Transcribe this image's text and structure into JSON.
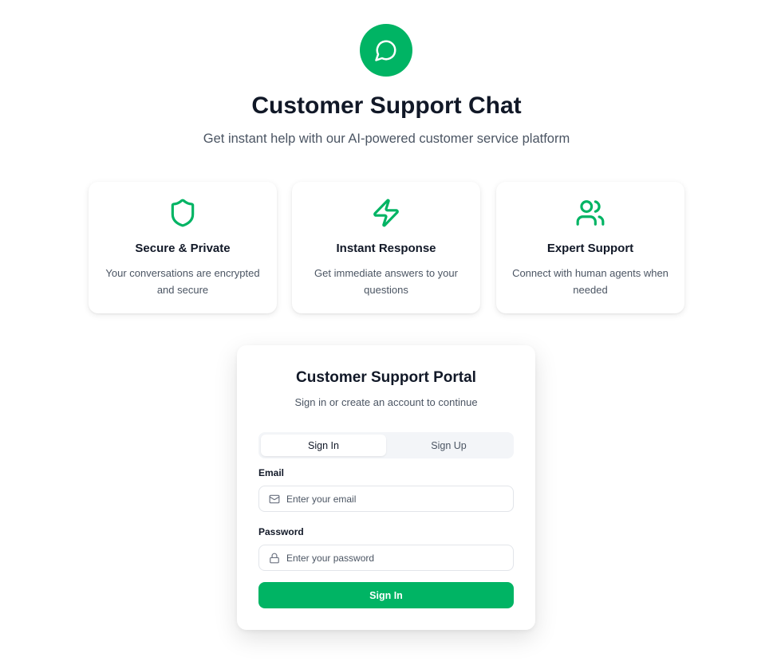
{
  "hero": {
    "icon": "chat-bubble-icon",
    "title": "Customer Support Chat",
    "subtitle": "Get instant help with our AI-powered customer service platform"
  },
  "features": [
    {
      "icon": "shield-icon",
      "title": "Secure & Private",
      "description": "Your conversations are encrypted and secure"
    },
    {
      "icon": "lightning-icon",
      "title": "Instant Response",
      "description": "Get immediate answers to your questions"
    },
    {
      "icon": "users-icon",
      "title": "Expert Support",
      "description": "Connect with human agents when needed"
    }
  ],
  "portal": {
    "title": "Customer Support Portal",
    "subtitle": "Sign in or create an account to continue",
    "tabs": [
      {
        "label": "Sign In",
        "active": true
      },
      {
        "label": "Sign Up",
        "active": false
      }
    ],
    "email": {
      "label": "Email",
      "value": "",
      "placeholder": "Enter your email",
      "icon": "mail-icon"
    },
    "password": {
      "label": "Password",
      "value": "",
      "placeholder": "Enter your password",
      "icon": "lock-icon"
    },
    "submit_label": "Sign In"
  },
  "colors": {
    "accent": "#00b464",
    "text_primary": "#111827",
    "text_secondary": "#4b5563"
  }
}
